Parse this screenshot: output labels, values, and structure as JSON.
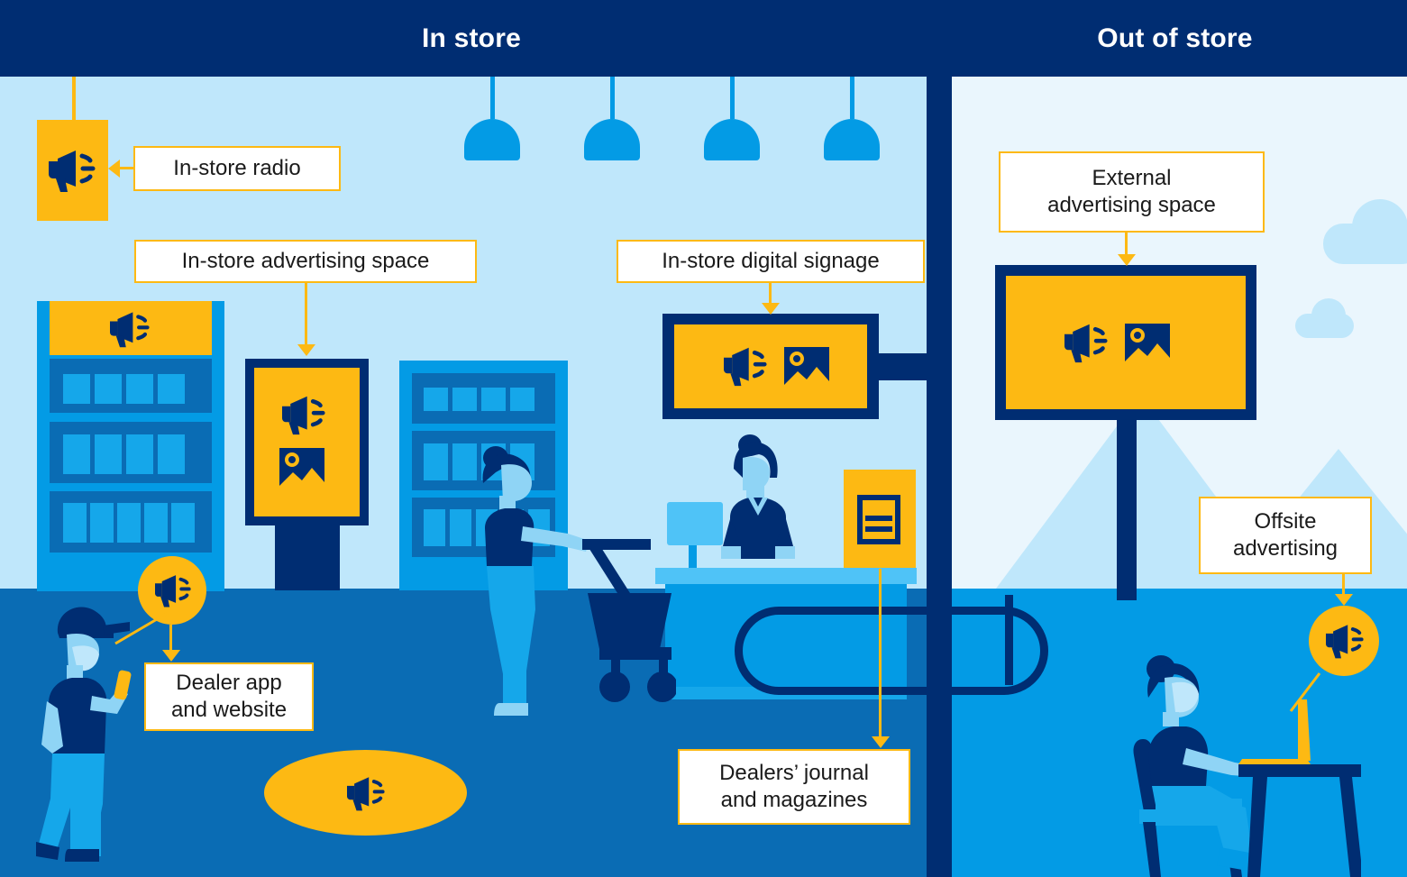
{
  "header": {
    "left_title": "In store",
    "right_title": "Out of store",
    "bg_color": "#002d72",
    "text_color": "#ffffff"
  },
  "palette": {
    "navy": "#002d72",
    "yellow": "#fdb913",
    "sky_light": "#bfe7fb",
    "sky_pale": "#eaf6fd",
    "blue_mid": "#039be5",
    "blue_deep": "#0a6cb4",
    "blue_light": "#4fc3f7",
    "white": "#ffffff"
  },
  "callouts": [
    {
      "id": "in-store-radio",
      "label": "In-store radio"
    },
    {
      "id": "in-store-advertising",
      "label": "In-store advertising space"
    },
    {
      "id": "in-store-digital-signage",
      "label": "In-store digital signage"
    },
    {
      "id": "external-advertising",
      "label": "External\nadvertising space",
      "line1": "External",
      "line2": "advertising space"
    },
    {
      "id": "offsite-advertising",
      "label": "Offsite advertising",
      "line1": "Offsite",
      "line2": "advertising"
    },
    {
      "id": "dealer-app-website",
      "label": "Dealer app and website",
      "line1": "Dealer app",
      "line2": "and website"
    },
    {
      "id": "dealers-journal",
      "label": "Dealers’ journal and magazines",
      "line1": "Dealers’ journal",
      "line2": "and magazines"
    }
  ],
  "icons": {
    "megaphone": "megaphone-icon",
    "picture": "picture-icon",
    "document": "document-icon"
  },
  "scene": {
    "in_store_elements": [
      "ceiling-lamps",
      "shelving-units",
      "product-kiosk",
      "digital-signage",
      "checkout-counter",
      "queue-rail",
      "magazine-rack",
      "floor-decal",
      "shopper-with-cart",
      "shopper-with-phone",
      "cashier"
    ],
    "out_of_store_elements": [
      "billboard",
      "mountains",
      "clouds",
      "person-at-laptop"
    ]
  }
}
